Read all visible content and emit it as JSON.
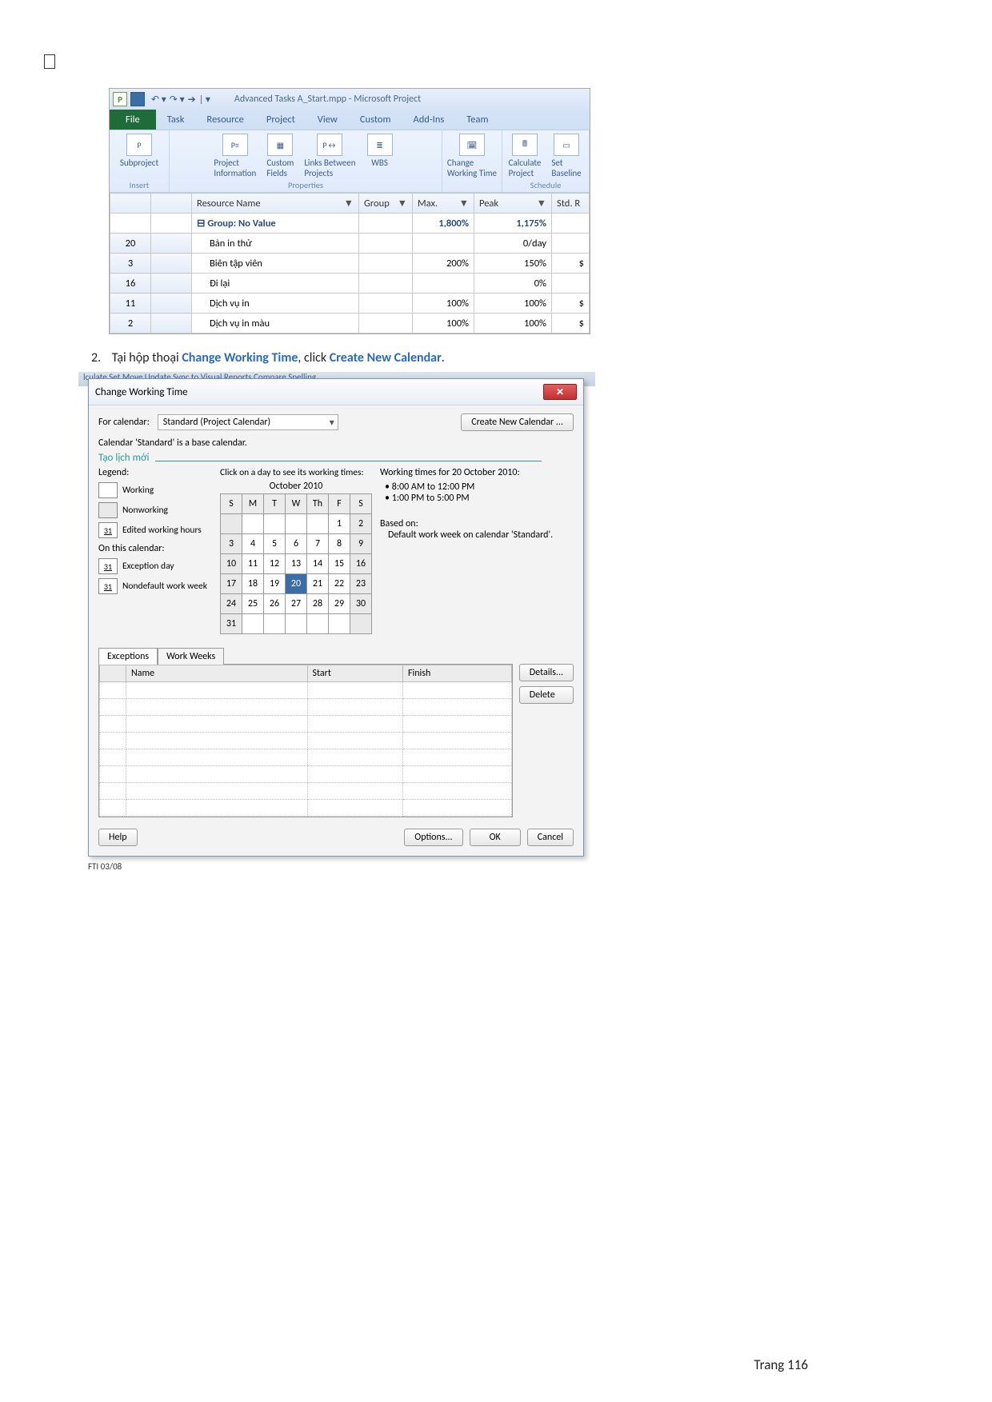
{
  "shot1": {
    "title": "Advanced Tasks A_Start.mpp  -  Microsoft Project",
    "tabs": {
      "file": "File",
      "task": "Task",
      "resource": "Resource",
      "project": "Project",
      "view": "View",
      "custom": "Custom",
      "addins": "Add-Ins",
      "team": "Team"
    },
    "ribbon": {
      "insert": {
        "subproject": "Subproject",
        "group": "Insert"
      },
      "properties": {
        "projectinfo": "Project\nInformation",
        "customfields": "Custom\nFields",
        "links": "Links Between\nProjects",
        "wbs": "WBS",
        "group": "Properties"
      },
      "changewt": "Change\nWorking Time",
      "calcproj": "Calculate\nProject",
      "setbaseline": "Set\nBaseline",
      "schedule": "Schedule"
    },
    "columns": {
      "resname": "Resource Name",
      "group": "Group",
      "max": "Max.",
      "peak": "Peak",
      "std": "Std. R"
    },
    "grouprow": {
      "label": "Group: No Value",
      "max": "1,800%",
      "peak": "1,175%"
    },
    "rows": [
      {
        "n": "20",
        "name": "Bản in thử",
        "max": "",
        "peak": "0/day",
        "std": ""
      },
      {
        "n": "3",
        "name": "Biên tập viên",
        "max": "200%",
        "peak": "150%",
        "std": "$"
      },
      {
        "n": "16",
        "name": "Đi lại",
        "max": "",
        "peak": "0%",
        "std": ""
      },
      {
        "n": "11",
        "name": "Dịch vụ in",
        "max": "100%",
        "peak": "100%",
        "std": "$"
      },
      {
        "n": "2",
        "name": "Dịch vụ in màu",
        "max": "100%",
        "peak": "100%",
        "std": "$"
      }
    ]
  },
  "instruction": {
    "num": "2.",
    "pre": "Tại hộp thoại ",
    "b1": "Change Working Time",
    "mid": ", click ",
    "b2": "Create New Calendar",
    "post": "."
  },
  "shot2": {
    "backtext": "lculate   Set   Move                      Update          Sync to            Visual  Reports Compare  Spelling",
    "title": "Change Working Time",
    "for_label": "For calendar:",
    "for_value": "Standard (Project Calendar)",
    "create_btn": "Create New Calendar ...",
    "basenote": "Calendar 'Standard' is a base calendar.",
    "tao": "Tạo lịch mới",
    "legend_title": "Legend:",
    "legend": {
      "working": "Working",
      "nonworking": "Nonworking",
      "edited": "Edited working hours",
      "onthis": "On this calendar:",
      "exception": "Exception day",
      "nondefault": "Nondefault work week",
      "d31": "31"
    },
    "calhint": "Click on a day to see its working times:",
    "calmonth": "October 2010",
    "dow": [
      "S",
      "M",
      "T",
      "W",
      "Th",
      "F",
      "S"
    ],
    "cal": [
      [
        "",
        "",
        "",
        "",
        "",
        "1",
        "2"
      ],
      [
        "3",
        "4",
        "5",
        "6",
        "7",
        "8",
        "9"
      ],
      [
        "10",
        "11",
        "12",
        "13",
        "14",
        "15",
        "16"
      ],
      [
        "17",
        "18",
        "19",
        "20",
        "21",
        "22",
        "23"
      ],
      [
        "24",
        "25",
        "26",
        "27",
        "28",
        "29",
        "30"
      ],
      [
        "31",
        "",
        "",
        "",
        "",
        "",
        ""
      ]
    ],
    "wt_title": "Working times for 20 October 2010:",
    "wt": [
      "8:00 AM to 12:00 PM",
      "1:00 PM to 5:00 PM"
    ],
    "based_label": "Based on:",
    "based_value": "Default work week on calendar 'Standard'.",
    "tabs": {
      "exceptions": "Exceptions",
      "workweeks": "Work Weeks"
    },
    "cols": {
      "name": "Name",
      "start": "Start",
      "finish": "Finish"
    },
    "side": {
      "details": "Details...",
      "delete": "Delete"
    },
    "foot": {
      "help": "Help",
      "options": "Options...",
      "ok": "OK",
      "cancel": "Cancel"
    },
    "fit": "FTI 03/08"
  },
  "page_label": "Trang 116"
}
